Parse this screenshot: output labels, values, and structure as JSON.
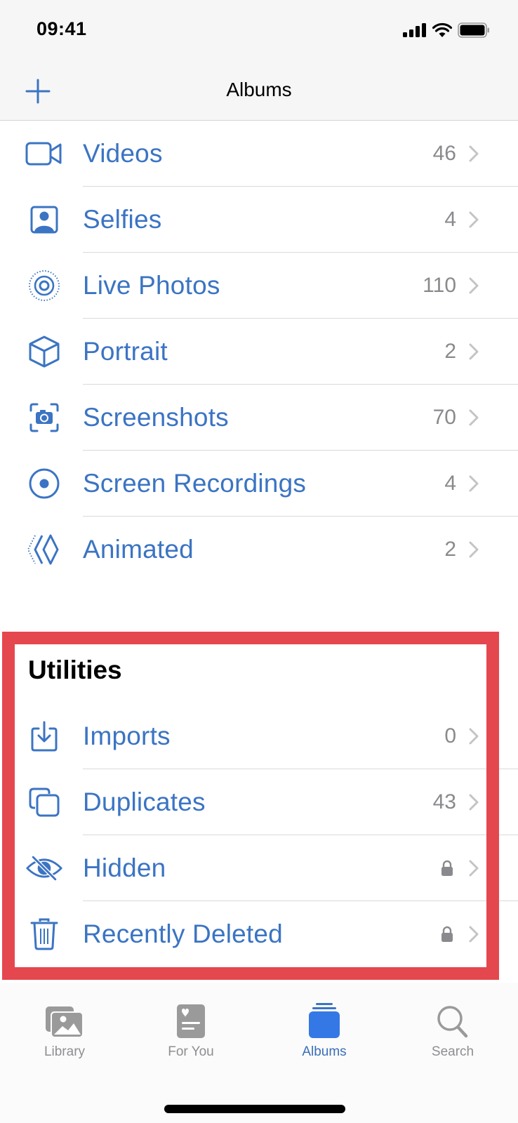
{
  "status_bar": {
    "time": "09:41",
    "icons": [
      "cellular-signal-icon",
      "wifi-icon",
      "battery-icon"
    ]
  },
  "nav": {
    "title": "Albums",
    "add_icon": "plus-icon"
  },
  "media_types": [
    {
      "label": "Videos",
      "count": "46",
      "icon": "video-camera-icon"
    },
    {
      "label": "Selfies",
      "count": "4",
      "icon": "selfie-portrait-icon"
    },
    {
      "label": "Live Photos",
      "count": "110",
      "icon": "live-photo-icon"
    },
    {
      "label": "Portrait",
      "count": "2",
      "icon": "cube-icon"
    },
    {
      "label": "Screenshots",
      "count": "70",
      "icon": "screenshot-camera-icon"
    },
    {
      "label": "Screen Recordings",
      "count": "4",
      "icon": "record-circle-icon"
    },
    {
      "label": "Animated",
      "count": "2",
      "icon": "animated-diamond-icon"
    }
  ],
  "utilities": {
    "title": "Utilities",
    "items": [
      {
        "label": "Imports",
        "count": "0",
        "icon": "import-tray-icon",
        "locked": false
      },
      {
        "label": "Duplicates",
        "count": "43",
        "icon": "duplicate-squares-icon",
        "locked": false
      },
      {
        "label": "Hidden",
        "count": "",
        "icon": "eye-slash-icon",
        "locked": true
      },
      {
        "label": "Recently Deleted",
        "count": "",
        "icon": "trash-icon",
        "locked": true
      }
    ]
  },
  "tab_bar": {
    "active": "Albums",
    "tabs": [
      {
        "label": "Library",
        "icon": "photo-library-icon"
      },
      {
        "label": "For You",
        "icon": "for-you-heart-card-icon"
      },
      {
        "label": "Albums",
        "icon": "albums-stack-icon"
      },
      {
        "label": "Search",
        "icon": "magnifying-glass-icon"
      }
    ]
  },
  "colors": {
    "accent": "#3b74c3",
    "count_gray": "#8a8a8e",
    "highlight_border": "#e5474f",
    "tab_active": "#3a6fb8",
    "tab_inactive": "#8e8e93"
  }
}
